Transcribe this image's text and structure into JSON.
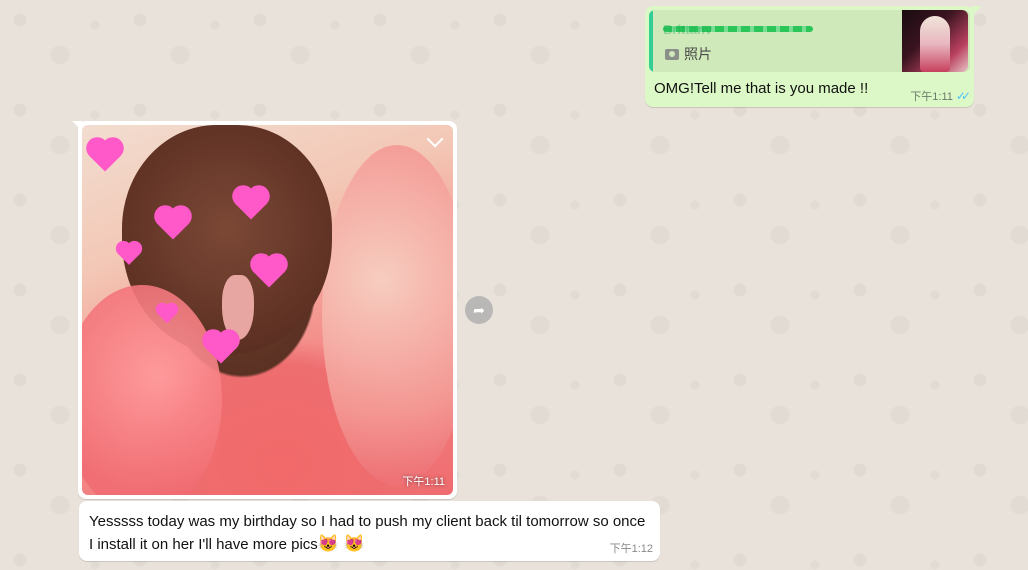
{
  "messages": {
    "outgoing": {
      "quote_author": "Brittany",
      "quote_type_label": "照片",
      "text": "OMG!Tell me that is you made !!",
      "time": "下午1:11",
      "ticks": "✓✓"
    },
    "incoming_image": {
      "time": "下午1:11"
    },
    "incoming_text": {
      "text": "Yesssss today was my birthday so I had to push my client back til tomorrow so once I install it on her I'll have more pics",
      "emoji": "😻 😻",
      "time": "下午1:12"
    }
  },
  "icons": {
    "forward": "forward-icon",
    "chevron": "chevron-down-icon",
    "camera": "camera-icon",
    "read_receipt": "double-check-icon"
  },
  "colors": {
    "outgoing_bubble": "#dcf8c6",
    "incoming_bubble": "#ffffff",
    "quote_bar": "#35cd96",
    "read_ticks": "#4fc3f7"
  }
}
